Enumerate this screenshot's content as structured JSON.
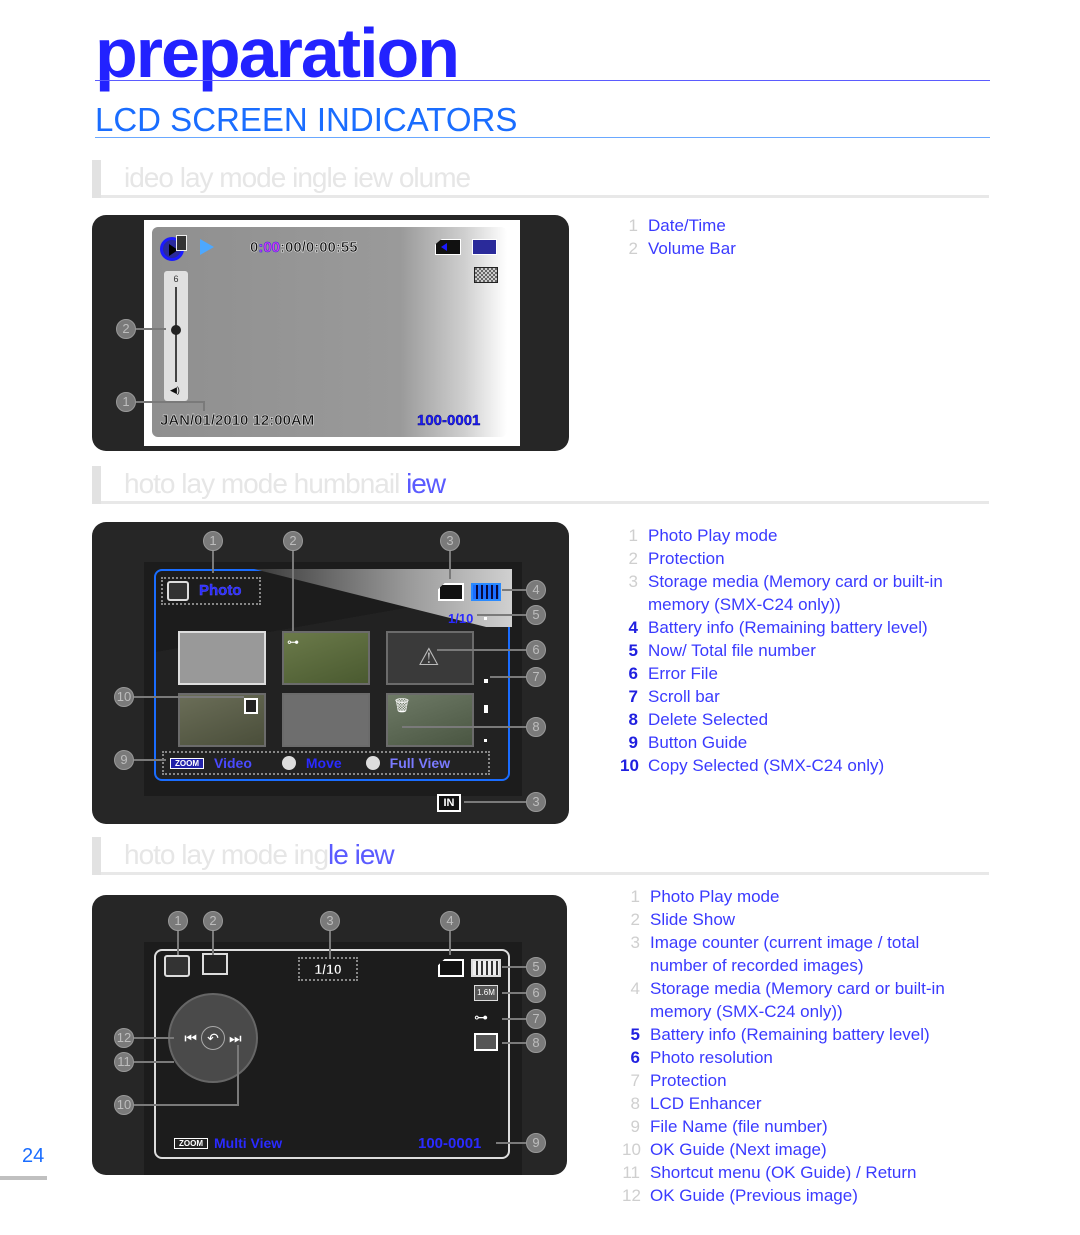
{
  "page": {
    "chapter_title": "preparation",
    "section_title": "LCD SCREEN INDICATORS",
    "page_number": "24"
  },
  "sections": [
    {
      "heading_faded": "ideo  lay mode    ingle  iew   olume",
      "heading_highlight": "",
      "screen": {
        "time_prefix": "0",
        "time_colored": ":00",
        "time_rest": ":00/0:00:55",
        "volume_level": "6",
        "datetime": "JAN/01/2010 12:00AM",
        "file_number": "100-0001",
        "callouts": [
          "1",
          "2"
        ]
      },
      "legend": [
        {
          "num": "1",
          "label": "Date/Time",
          "bold": false
        },
        {
          "num": "2",
          "label": "Volume Bar",
          "bold": false
        }
      ]
    },
    {
      "heading_faded": "hoto  lay mode    humbnail ",
      "heading_highlight": "iew",
      "screen": {
        "mode_label": "Photo",
        "counter": "1/10",
        "storage_internal": "IN",
        "guide": {
          "zoom_label": "ZOOM",
          "zoom_action": "Video",
          "move_action": "Move",
          "full_action": "Full View"
        },
        "callouts": [
          "1",
          "2",
          "3",
          "4",
          "5",
          "6",
          "7",
          "8",
          "9",
          "10",
          "3"
        ]
      },
      "legend": [
        {
          "num": "1",
          "label": "Photo Play mode",
          "bold": false
        },
        {
          "num": "2",
          "label": "Protection",
          "bold": false
        },
        {
          "num": "3",
          "label": "Storage media (Memory card or built-in memory (SMX-C24 only))",
          "bold": false
        },
        {
          "num": "4",
          "label": "Battery info (Remaining battery level)",
          "bold": true
        },
        {
          "num": "5",
          "label": "Now/ Total file number",
          "bold": true
        },
        {
          "num": "6",
          "label": "Error File",
          "bold": true
        },
        {
          "num": "7",
          "label": "Scroll bar",
          "bold": true
        },
        {
          "num": "8",
          "label": "Delete Selected",
          "bold": true
        },
        {
          "num": "9",
          "label": "Button Guide",
          "bold": true
        },
        {
          "num": "10",
          "label": "Copy Selected (SMX-C24 only)",
          "bold": true
        }
      ]
    },
    {
      "heading_faded": "hoto  lay mode    ing",
      "heading_highlight": "le  iew",
      "screen": {
        "counter": "1/10",
        "resolution": "1.6M",
        "zoom_label": "ZOOM",
        "zoom_action": "Multi View",
        "file_number": "100-0001",
        "callouts": [
          "1",
          "2",
          "3",
          "4",
          "5",
          "6",
          "7",
          "8",
          "9",
          "10",
          "11",
          "12"
        ]
      },
      "legend": [
        {
          "num": "1",
          "label": "Photo Play mode",
          "bold": false
        },
        {
          "num": "2",
          "label": "Slide Show",
          "bold": false
        },
        {
          "num": "3",
          "label": "Image counter (current image / total number of recorded images)",
          "bold": false
        },
        {
          "num": "4",
          "label": "Storage media (Memory card or built-in memory (SMX-C24 only))",
          "bold": false
        },
        {
          "num": "5",
          "label": "Battery info (Remaining battery level)",
          "bold": true
        },
        {
          "num": "6",
          "label": "Photo resolution",
          "bold": true
        },
        {
          "num": "7",
          "label": "Protection",
          "bold": false
        },
        {
          "num": "8",
          "label": "LCD Enhancer",
          "bold": false
        },
        {
          "num": "9",
          "label": "File Name (file number)",
          "bold": false
        },
        {
          "num": "10",
          "label": "OK Guide (Next image)",
          "bold": false
        },
        {
          "num": "11",
          "label": "Shortcut menu (OK Guide) / Return",
          "bold": false
        },
        {
          "num": "12",
          "label": "OK Guide (Previous image)",
          "bold": false
        }
      ]
    }
  ]
}
